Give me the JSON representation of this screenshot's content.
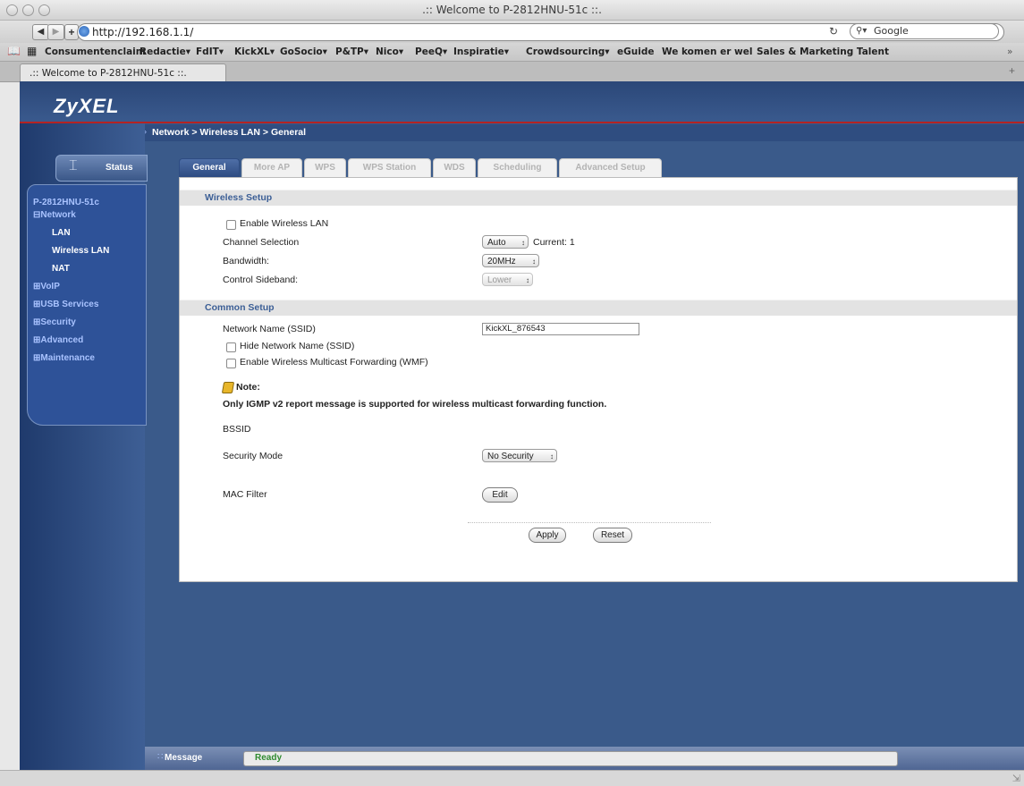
{
  "window": {
    "title": ".:: Welcome to P-2812HNU-51c ::."
  },
  "browser": {
    "url": "http://192.168.1.1/",
    "search_placeholder": "Google",
    "reload_icon": "reload-icon",
    "bookmarks": [
      "Consumentenclaim",
      "Redactie▾",
      "FdIT▾",
      "KickXL▾",
      "GoSocio▾",
      "P&TP▾",
      "Nico▾",
      "PeeQ▾",
      "Inspiratie▾",
      "Crowdsourcing▾",
      "eGuide",
      "We komen er wel",
      "Sales & Marketing Talent"
    ],
    "overflow": "»",
    "tab_title": ".:: Welcome to P-2812HNU-51c ::.",
    "new_tab": "+"
  },
  "router": {
    "logo": "ZyXEL",
    "breadcrumb": "Network > Wireless LAN > General",
    "status_label": "Status",
    "model": "P-2812HNU-51c",
    "nav": {
      "network": "Network",
      "lan": "LAN",
      "wireless_lan": "Wireless LAN",
      "nat": "NAT",
      "voip": "VoIP",
      "usb_services": "USB Services",
      "security": "Security",
      "advanced": "Advanced",
      "maintenance": "Maintenance"
    },
    "tabs": [
      "General",
      "More AP",
      "WPS",
      "WPS Station",
      "WDS",
      "Scheduling",
      "Advanced Setup"
    ],
    "wireless_setup": {
      "title": "Wireless Setup",
      "enable_wlan": "Enable Wireless LAN",
      "channel_label": "Channel Selection",
      "channel_value": "Auto",
      "channel_current": "Current: 1",
      "bandwidth_label": "Bandwidth:",
      "bandwidth_value": "20MHz",
      "sideband_label": "Control Sideband:",
      "sideband_value": "Lower"
    },
    "common_setup": {
      "title": "Common Setup",
      "ssid_label": "Network Name (SSID)",
      "ssid_value": "KickXL_876543",
      "hide_ssid": "Hide Network Name (SSID)",
      "wmf": "Enable Wireless Multicast Forwarding (WMF)",
      "note_title": "Note:",
      "note_text": "Only IGMP v2 report message is supported for wireless multicast forwarding function.",
      "bssid_label": "BSSID",
      "security_label": "Security Mode",
      "security_value": "No Security",
      "mac_label": "MAC Filter",
      "edit_label": "Edit"
    },
    "actions": {
      "apply": "Apply",
      "reset": "Reset"
    },
    "message": {
      "label": "Message",
      "value": "Ready"
    }
  }
}
